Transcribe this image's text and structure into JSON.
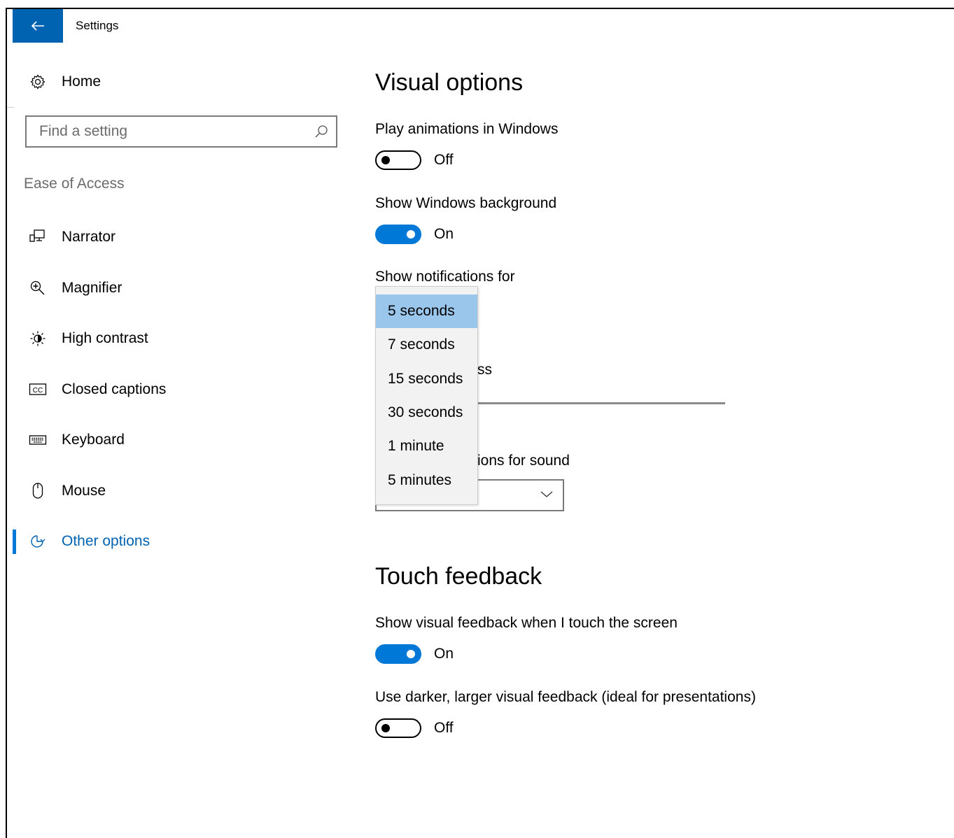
{
  "window": {
    "title": "Settings",
    "back_icon": "back-arrow-icon"
  },
  "sidebar": {
    "home_label": "Home",
    "search": {
      "placeholder": "Find a setting",
      "value": ""
    },
    "section_label": "Ease of Access",
    "items": [
      {
        "label": "Narrator",
        "icon": "narrator-icon",
        "active": false
      },
      {
        "label": "Magnifier",
        "icon": "magnifier-icon",
        "active": false
      },
      {
        "label": "High contrast",
        "icon": "high-contrast-icon",
        "active": false
      },
      {
        "label": "Closed captions",
        "icon": "closed-captions-icon",
        "active": false
      },
      {
        "label": "Keyboard",
        "icon": "keyboard-icon",
        "active": false
      },
      {
        "label": "Mouse",
        "icon": "mouse-icon",
        "active": false
      },
      {
        "label": "Other options",
        "icon": "other-options-icon",
        "active": true
      }
    ]
  },
  "main": {
    "visual_title": "Visual options",
    "play_animations": {
      "label": "Play animations in Windows",
      "state": "Off"
    },
    "show_background": {
      "label": "Show Windows background",
      "state": "On"
    },
    "notifications": {
      "label": "Show notifications for",
      "options": [
        "5 seconds",
        "7 seconds",
        "15 seconds",
        "30 seconds",
        "1 minute",
        "5 minutes"
      ],
      "selected": "5 seconds"
    },
    "partial_thickness_text": "ss",
    "partial_sound_text": "ions for sound",
    "touch_title": "Touch feedback",
    "touch_feedback": {
      "label": "Show visual feedback when I touch the screen",
      "state": "On"
    },
    "darker_feedback": {
      "label": "Use darker, larger visual feedback (ideal for presentations)",
      "state": "Off"
    }
  },
  "colors": {
    "accent": "#0078d7",
    "titlebar_button": "#0063b1",
    "dropdown_selected": "#99c6ea"
  }
}
